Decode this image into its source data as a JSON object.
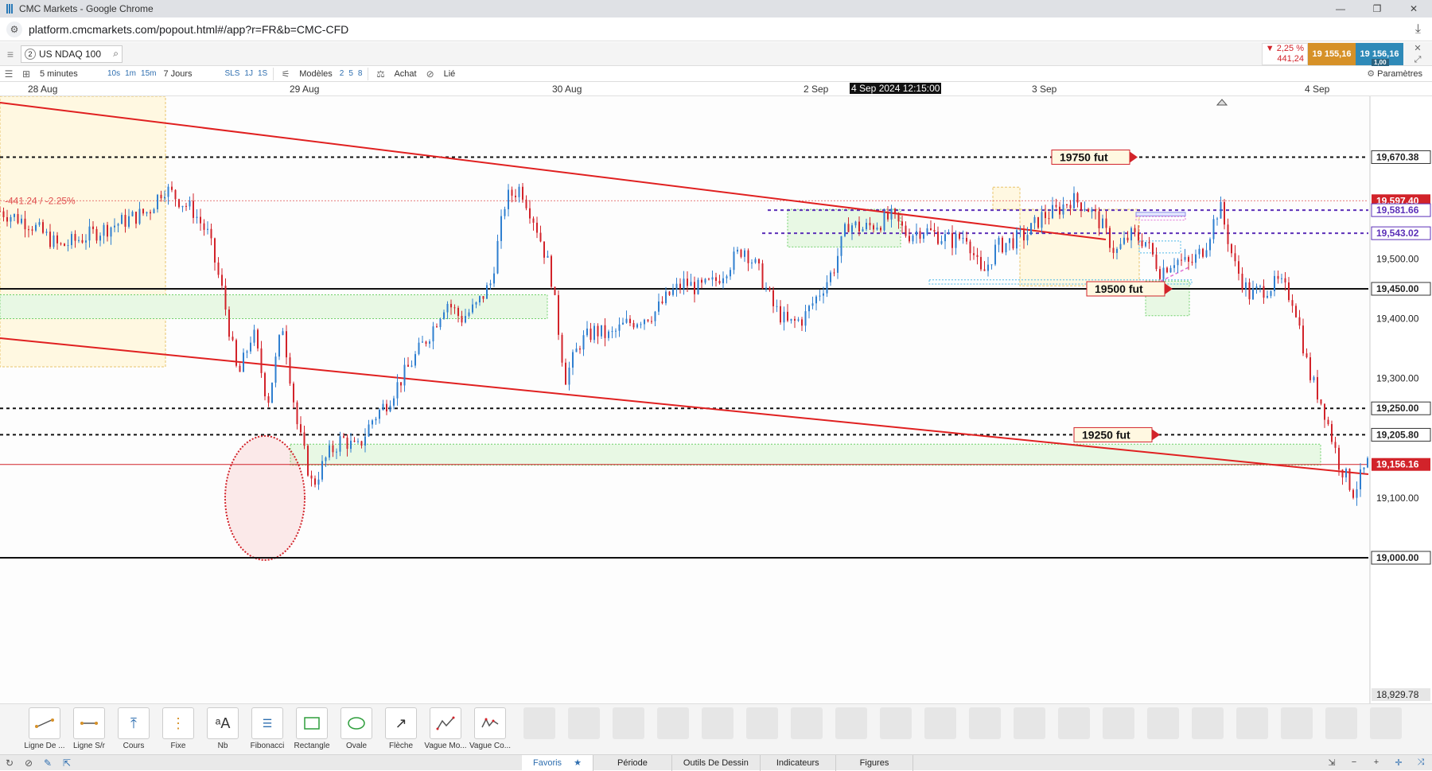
{
  "window": {
    "title": "CMC Markets - Google Chrome",
    "controls": [
      "—",
      "❐",
      "✕"
    ]
  },
  "browser": {
    "url": "platform.cmcmarkets.com/popout.html#/app?r=FR&b=CMC-CFD"
  },
  "instrument": {
    "number": "2",
    "name": "US NDAQ 100",
    "change_pct": "▼ 2,25 %",
    "change_pts": "441,24",
    "sell_price": "19 155,16",
    "buy_price": "19 156,16",
    "spread": "1,00"
  },
  "toolbar": {
    "timeframe": "5 minutes",
    "tf_buttons": [
      "10s",
      "1m",
      "15m"
    ],
    "range": "7 Jours",
    "range_buttons": [
      "SLS",
      "1J",
      "1S"
    ],
    "modeles": "Modèles",
    "mod_buttons": [
      "2",
      "5",
      "8"
    ],
    "achat": "Achat",
    "lie": "Lié",
    "parametres": "Paramètres"
  },
  "date_axis": {
    "labels": [
      "28 Aug",
      "29 Aug",
      "30 Aug",
      "2 Sep",
      "3 Sep",
      "4 Sep"
    ],
    "crosshair_date": "4 Sep 2024 12:15:00"
  },
  "chart_data": {
    "type": "candlestick",
    "ylim": [
      18929.78,
      19700
    ],
    "price_labels": [
      {
        "text": "19,670.38",
        "value": 19670.38,
        "style": "normal"
      },
      {
        "text": "19,597.40",
        "value": 19597.4,
        "style": "red"
      },
      {
        "text": "19,581.66",
        "value": 19581.66,
        "style": "purple"
      },
      {
        "text": "19,543.02",
        "value": 19543.02,
        "style": "purple"
      },
      {
        "text": "19,500.00",
        "value": 19500.0,
        "style": "plain"
      },
      {
        "text": "19,450.00",
        "value": 19450.0,
        "style": "normal"
      },
      {
        "text": "19,400.00",
        "value": 19400.0,
        "style": "plain"
      },
      {
        "text": "19,300.00",
        "value": 19300.0,
        "style": "plain"
      },
      {
        "text": "19,250.00",
        "value": 19250.0,
        "style": "normal"
      },
      {
        "text": "19,205.80",
        "value": 19205.8,
        "style": "normal"
      },
      {
        "text": "19,156.16",
        "value": 19156.16,
        "style": "red"
      },
      {
        "text": "19,100.00",
        "value": 19100.0,
        "style": "plain"
      },
      {
        "text": "19,000.00",
        "value": 19000.0,
        "style": "normal"
      },
      {
        "text": "18,929.78",
        "value": 18929.78,
        "style": "plain"
      }
    ],
    "change_label": "-441.24 / -2.25%",
    "annotations": [
      {
        "text": "19750  fut",
        "value": 19670.38
      },
      {
        "text": "19500  fut",
        "value": 19450.0
      },
      {
        "text": "19250  fut",
        "value": 19205.8
      }
    ],
    "price_path": [
      [
        0,
        19580
      ],
      [
        2,
        19560
      ],
      [
        4,
        19520
      ],
      [
        6,
        19540
      ],
      [
        8,
        19560
      ],
      [
        10,
        19580
      ],
      [
        11,
        19620
      ],
      [
        12,
        19600
      ],
      [
        13,
        19580
      ],
      [
        14,
        19540
      ],
      [
        15,
        19440
      ],
      [
        16,
        19300
      ],
      [
        17,
        19380
      ],
      [
        18,
        19260
      ],
      [
        19,
        19390
      ],
      [
        20,
        19220
      ],
      [
        21,
        19120
      ],
      [
        22,
        19170
      ],
      [
        23,
        19200
      ],
      [
        24,
        19180
      ],
      [
        25,
        19230
      ],
      [
        26,
        19260
      ],
      [
        27,
        19300
      ],
      [
        28,
        19340
      ],
      [
        29,
        19380
      ],
      [
        30,
        19430
      ],
      [
        31,
        19400
      ],
      [
        32,
        19420
      ],
      [
        33,
        19460
      ],
      [
        34,
        19600
      ],
      [
        35,
        19620
      ],
      [
        36,
        19560
      ],
      [
        37,
        19480
      ],
      [
        38,
        19300
      ],
      [
        39,
        19360
      ],
      [
        40,
        19380
      ],
      [
        41,
        19370
      ],
      [
        42,
        19390
      ],
      [
        43,
        19400
      ],
      [
        44,
        19410
      ],
      [
        45,
        19440
      ],
      [
        46,
        19460
      ],
      [
        47,
        19450
      ],
      [
        48,
        19460
      ],
      [
        49,
        19490
      ],
      [
        50,
        19520
      ],
      [
        51,
        19480
      ],
      [
        52,
        19420
      ],
      [
        53,
        19390
      ],
      [
        54,
        19400
      ],
      [
        55,
        19440
      ],
      [
        56,
        19480
      ],
      [
        57,
        19560
      ],
      [
        58,
        19550
      ],
      [
        59,
        19560
      ],
      [
        60,
        19570
      ],
      [
        61,
        19540
      ],
      [
        62,
        19550
      ],
      [
        63,
        19540
      ],
      [
        64,
        19530
      ],
      [
        65,
        19540
      ],
      [
        66,
        19470
      ],
      [
        67,
        19520
      ],
      [
        68,
        19530
      ],
      [
        69,
        19540
      ],
      [
        70,
        19570
      ],
      [
        71,
        19580
      ],
      [
        72,
        19600
      ],
      [
        73,
        19590
      ],
      [
        74,
        19560
      ],
      [
        75,
        19510
      ],
      [
        76,
        19540
      ],
      [
        77,
        19530
      ],
      [
        78,
        19480
      ],
      [
        79,
        19500
      ],
      [
        80,
        19490
      ],
      [
        81,
        19520
      ],
      [
        82,
        19590
      ],
      [
        83,
        19490
      ],
      [
        84,
        19440
      ],
      [
        85,
        19450
      ],
      [
        86,
        19460
      ],
      [
        87,
        19430
      ],
      [
        88,
        19310
      ],
      [
        89,
        19250
      ],
      [
        90,
        19160
      ],
      [
        91,
        19110
      ],
      [
        92,
        19160
      ]
    ]
  },
  "drawing_tools": [
    {
      "label": "Ligne De ...",
      "icon": "line-icon"
    },
    {
      "label": "Ligne S/r",
      "icon": "sr-line-icon"
    },
    {
      "label": "Cours",
      "icon": "price-icon"
    },
    {
      "label": "Fixe",
      "icon": "fixed-icon"
    },
    {
      "label": "Nb",
      "icon": "text-icon"
    },
    {
      "label": "Fibonacci",
      "icon": "fibonacci-icon"
    },
    {
      "label": "Rectangle",
      "icon": "rectangle-icon"
    },
    {
      "label": "Ovale",
      "icon": "oval-icon"
    },
    {
      "label": "Flèche",
      "icon": "arrow-icon"
    },
    {
      "label": "Vague Mo...",
      "icon": "wave-icon"
    },
    {
      "label": "Vague Co...",
      "icon": "wave-corrective-icon"
    }
  ],
  "bottom_tabs": {
    "favoris": "Favoris",
    "periode": "Période",
    "outils": "Outils De Dessin",
    "indicateurs": "Indicateurs",
    "figures": "Figures"
  }
}
